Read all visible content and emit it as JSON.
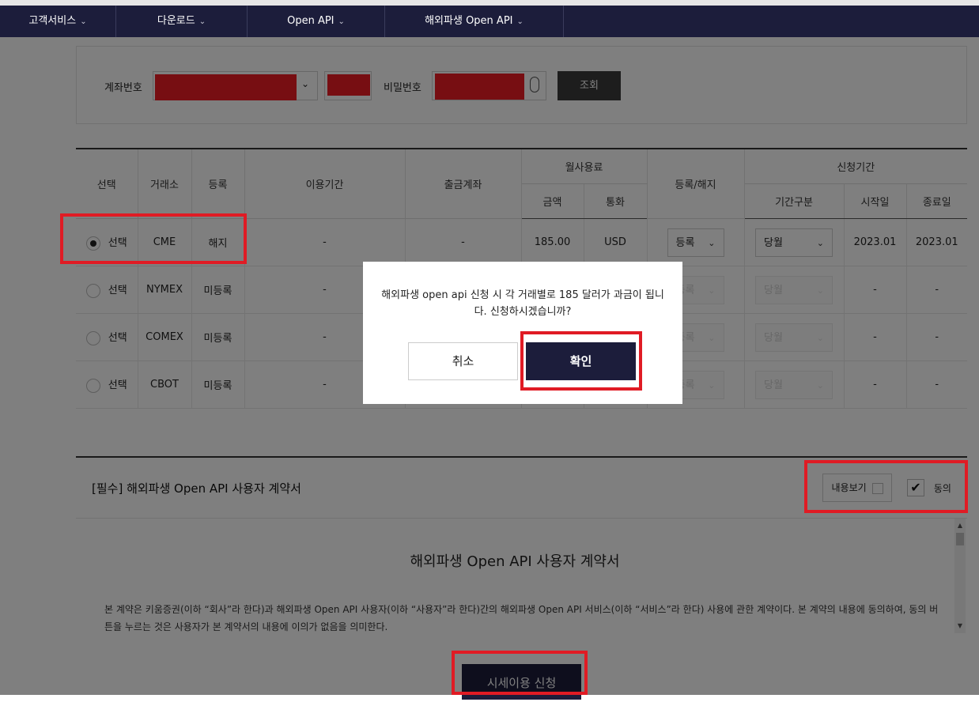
{
  "nav": {
    "items": [
      {
        "label": "고객서비스"
      },
      {
        "label": "다운로드"
      },
      {
        "label": "Open API"
      },
      {
        "label": "해외파생 Open API"
      }
    ]
  },
  "account": {
    "account_label": "계좌번호",
    "password_label": "비밀번호",
    "search_button": "조회"
  },
  "table": {
    "headers": {
      "select": "선택",
      "exchange": "거래소",
      "registration": "등록",
      "period": "이용기간",
      "withdraw_account": "출금계좌",
      "monthly_fee": "월사용료",
      "amount": "금액",
      "currency": "통화",
      "reg_cancel": "등록/해지",
      "apply_period": "신청기간",
      "period_type": "기간구분",
      "start": "시작일",
      "end": "종료일"
    },
    "rows": [
      {
        "select": "선택",
        "selected": true,
        "exchange": "CME",
        "status": "해지",
        "period": "-",
        "account": "-",
        "amount": "185.00",
        "currency": "USD",
        "action": "등록",
        "period_type": "당월",
        "start": "2023.01",
        "end": "2023.01"
      },
      {
        "select": "선택",
        "selected": false,
        "exchange": "NYMEX",
        "status": "미등록",
        "period": "-",
        "account": "",
        "amount": "",
        "currency": "",
        "action": "등록",
        "period_type": "당월",
        "start": "-",
        "end": "-"
      },
      {
        "select": "선택",
        "selected": false,
        "exchange": "COMEX",
        "status": "미등록",
        "period": "-",
        "account": "",
        "amount": "",
        "currency": "",
        "action": "등록",
        "period_type": "당월",
        "start": "-",
        "end": "-"
      },
      {
        "select": "선택",
        "selected": false,
        "exchange": "CBOT",
        "status": "미등록",
        "period": "-",
        "account": "",
        "amount": "",
        "currency": "",
        "action": "등록",
        "period_type": "당월",
        "start": "-",
        "end": "-"
      }
    ]
  },
  "terms": {
    "title": "[필수] 해외파생 Open API 사용자 계약서",
    "view_button": "내용보기",
    "agree_label": "동의",
    "agree_checked": true,
    "heading": "해외파생 Open API 사용자 계약서",
    "body": "본 계약은 키움증권(이하 “회사”라 한다)과 해외파생 Open API 사용자(이하 “사용자”라 한다)간의 해외파생 Open API 서비스(이하 “서비스”라 한다) 사용에 관한 계약이다. 본 계약의 내용에 동의하여, 동의 버튼을 누르는 것은 사용자가 본 계약서의 내용에 이의가 없음을 의미한다."
  },
  "apply_button": "시세이용 신청",
  "modal": {
    "message": "해외파생 open api 신청 시 각 거래별로 185 달러가 과금이 됩니다. 신청하시겠습니까?",
    "cancel": "취소",
    "confirm": "확인"
  },
  "colors": {
    "nav_bg": "#1c1d3b",
    "highlight": "#e01b24",
    "redaction": "#ee1c24"
  }
}
